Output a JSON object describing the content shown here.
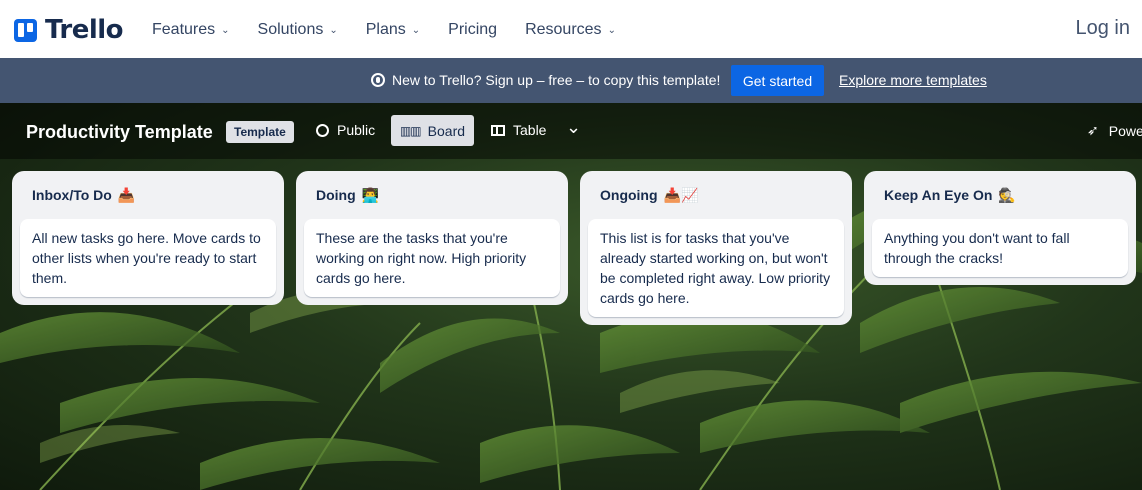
{
  "topnav": {
    "logo_text": "Trello",
    "links": [
      {
        "label": "Features",
        "has_chevron": true
      },
      {
        "label": "Solutions",
        "has_chevron": true
      },
      {
        "label": "Plans",
        "has_chevron": true
      },
      {
        "label": "Pricing",
        "has_chevron": false
      },
      {
        "label": "Resources",
        "has_chevron": true
      }
    ],
    "login": "Log in"
  },
  "banner": {
    "text": "New to Trello? Sign up – free – to copy this template!",
    "cta": "Get started",
    "explore": "Explore more templates"
  },
  "board": {
    "title": "Productivity Template",
    "badge": "Template",
    "visibility": "Public",
    "views": [
      "Board",
      "Table"
    ],
    "power_label": "Power-Ups"
  },
  "lists": [
    {
      "title": "Inbox/To Do",
      "emoji": "📥",
      "cards": [
        "All new tasks go here. Move cards to other lists when you're ready to start them."
      ]
    },
    {
      "title": "Doing",
      "emoji": "👨‍💻",
      "cards": [
        "These are the tasks that you're working on right now. High priority cards go here."
      ]
    },
    {
      "title": "Ongoing",
      "emoji": "📥📈",
      "cards": [
        "This list is for tasks that you've already started working on, but won't be completed right away. Low priority cards go here."
      ]
    },
    {
      "title": "Keep An Eye On",
      "emoji": "🕵️",
      "cards": [
        "Anything you don't want to fall through the cracks!"
      ]
    }
  ],
  "colors": {
    "brand_blue": "#0c66e4",
    "banner_bg": "#445571",
    "list_bg": "#f1f2f4",
    "text_dark": "#172b4d"
  }
}
